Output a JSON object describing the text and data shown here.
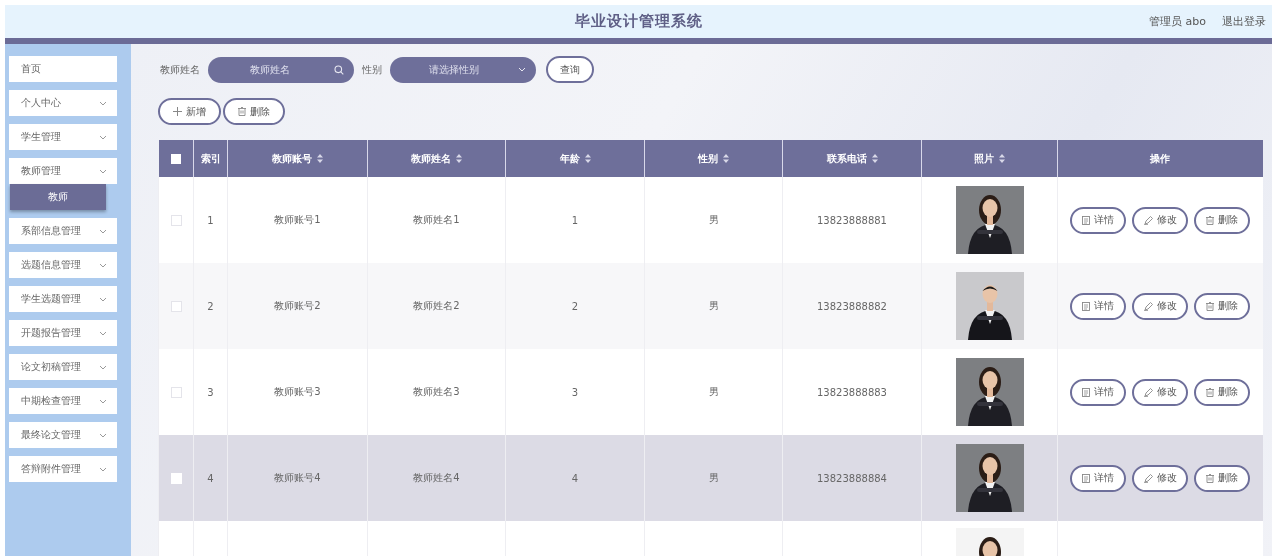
{
  "header": {
    "title": "毕业设计管理系统",
    "user": "管理员 abo",
    "logout": "退出登录"
  },
  "sidebar": {
    "items": [
      {
        "label": "首页",
        "expandable": false
      },
      {
        "label": "个人中心",
        "expandable": true
      },
      {
        "label": "学生管理",
        "expandable": true
      },
      {
        "label": "教师管理",
        "expandable": true,
        "expanded": true,
        "children": [
          {
            "label": "教师",
            "selected": true
          }
        ]
      },
      {
        "label": "系部信息管理",
        "expandable": true
      },
      {
        "label": "选题信息管理",
        "expandable": true
      },
      {
        "label": "学生选题管理",
        "expandable": true
      },
      {
        "label": "开题报告管理",
        "expandable": true
      },
      {
        "label": "论文初稿管理",
        "expandable": true
      },
      {
        "label": "中期检查管理",
        "expandable": true
      },
      {
        "label": "最终论文管理",
        "expandable": true
      },
      {
        "label": "答辩附件管理",
        "expandable": true
      }
    ]
  },
  "search": {
    "fields": [
      {
        "kind": "text",
        "label": "教师姓名",
        "placeholder": "教师姓名"
      },
      {
        "kind": "select",
        "label": "性别",
        "placeholder": "请选择性别"
      }
    ],
    "button": "查询"
  },
  "toolbar": [
    {
      "kind": "add",
      "label": "新增"
    },
    {
      "kind": "delete",
      "label": "删除"
    }
  ],
  "table": {
    "select_all_checked": false,
    "columns": [
      {
        "kind": "checkbox"
      },
      {
        "kind": "text",
        "label": "索引",
        "sortable": false
      },
      {
        "kind": "text",
        "label": "教师账号",
        "sortable": true
      },
      {
        "kind": "text",
        "label": "教师姓名",
        "sortable": true
      },
      {
        "kind": "text",
        "label": "年龄",
        "sortable": true
      },
      {
        "kind": "text",
        "label": "性别",
        "sortable": true
      },
      {
        "kind": "text",
        "label": "联系电话",
        "sortable": true
      },
      {
        "kind": "text",
        "label": "照片",
        "sortable": true
      },
      {
        "kind": "text",
        "label": "操作",
        "sortable": false
      }
    ],
    "rows": [
      {
        "partial": false,
        "checked": false,
        "highlighted": false,
        "index": "1",
        "account": "教师账号1",
        "name": "教师姓名1",
        "age": "1",
        "gender": "男",
        "phone": "13823888881",
        "actions": [
          {
            "kind": "detail",
            "label": "详情"
          },
          {
            "kind": "edit",
            "label": "修改"
          },
          {
            "kind": "delete",
            "label": "删除"
          }
        ]
      },
      {
        "partial": false,
        "checked": false,
        "highlighted": false,
        "index": "2",
        "account": "教师账号2",
        "name": "教师姓名2",
        "age": "2",
        "gender": "男",
        "phone": "13823888882",
        "actions": [
          {
            "kind": "detail",
            "label": "详情"
          },
          {
            "kind": "edit",
            "label": "修改"
          },
          {
            "kind": "delete",
            "label": "删除"
          }
        ]
      },
      {
        "partial": false,
        "checked": false,
        "highlighted": false,
        "index": "3",
        "account": "教师账号3",
        "name": "教师姓名3",
        "age": "3",
        "gender": "男",
        "phone": "13823888883",
        "actions": [
          {
            "kind": "detail",
            "label": "详情"
          },
          {
            "kind": "edit",
            "label": "修改"
          },
          {
            "kind": "delete",
            "label": "删除"
          }
        ]
      },
      {
        "partial": false,
        "checked": false,
        "highlighted": true,
        "index": "4",
        "account": "教师账号4",
        "name": "教师姓名4",
        "age": "4",
        "gender": "男",
        "phone": "13823888884",
        "actions": [
          {
            "kind": "detail",
            "label": "详情"
          },
          {
            "kind": "edit",
            "label": "修改"
          },
          {
            "kind": "delete",
            "label": "删除"
          }
        ]
      },
      {
        "partial": true,
        "highlighted": false
      }
    ]
  }
}
